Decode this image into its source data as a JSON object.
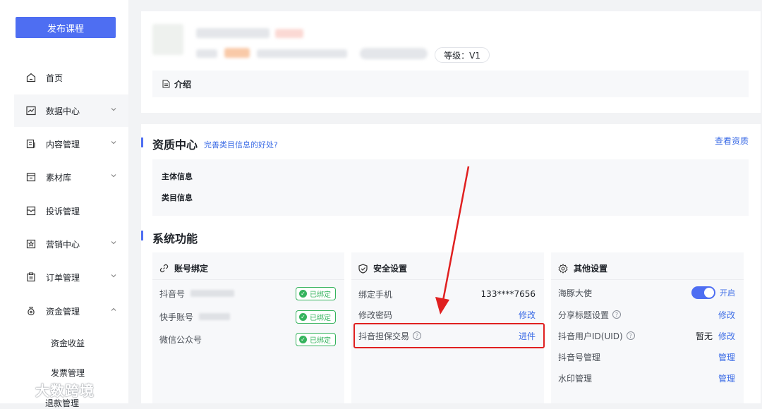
{
  "sidebar": {
    "publish_label": "发布课程",
    "items": [
      {
        "label": "首页",
        "icon": "home-icon"
      },
      {
        "label": "数据中心",
        "icon": "chart-icon"
      },
      {
        "label": "内容管理",
        "icon": "content-icon"
      },
      {
        "label": "素材库",
        "icon": "folder-icon"
      },
      {
        "label": "投诉管理",
        "icon": "complaint-icon"
      },
      {
        "label": "营销中心",
        "icon": "star-icon"
      },
      {
        "label": "订单管理",
        "icon": "clipboard-icon"
      },
      {
        "label": "资金管理",
        "icon": "money-bag-icon"
      }
    ],
    "sub_items": [
      "资金收益",
      "发票管理"
    ],
    "partial_item": "退款管理"
  },
  "profile": {
    "level_text": "等级：V1",
    "intro_label": "介绍"
  },
  "qualification": {
    "title": "资质中心",
    "hint_link": "完善类目信息的好处?",
    "view_link": "查看资质",
    "rows": [
      "主体信息",
      "类目信息"
    ]
  },
  "system": {
    "title": "系统功能",
    "account_binding": {
      "title": "账号绑定",
      "rows": [
        {
          "label": "抖音号",
          "status": "已绑定"
        },
        {
          "label": "快手账号",
          "status": "已绑定"
        },
        {
          "label": "微信公众号",
          "status": "已绑定"
        }
      ]
    },
    "security": {
      "title": "安全设置",
      "phone_label": "绑定手机",
      "phone_value": "133****7656",
      "password_label": "修改密码",
      "password_action": "修改",
      "escrow_label": "抖音担保交易",
      "escrow_action": "进件"
    },
    "other": {
      "title": "其他设置",
      "ambassador_label": "海豚大使",
      "ambassador_state": "开启",
      "share_label": "分享标题设置",
      "share_action": "修改",
      "uid_label": "抖音用户ID(UID)",
      "uid_value": "暂无",
      "uid_action": "修改",
      "dy_manage_label": "抖音号管理",
      "dy_manage_action": "管理",
      "watermark_label": "水印管理",
      "watermark_action": "管理"
    }
  },
  "watermark_text": "大数跨境",
  "colors": {
    "accent": "#4e6ef2",
    "link": "#3c6ce6",
    "success": "#35b35d",
    "highlight": "#e02020"
  }
}
